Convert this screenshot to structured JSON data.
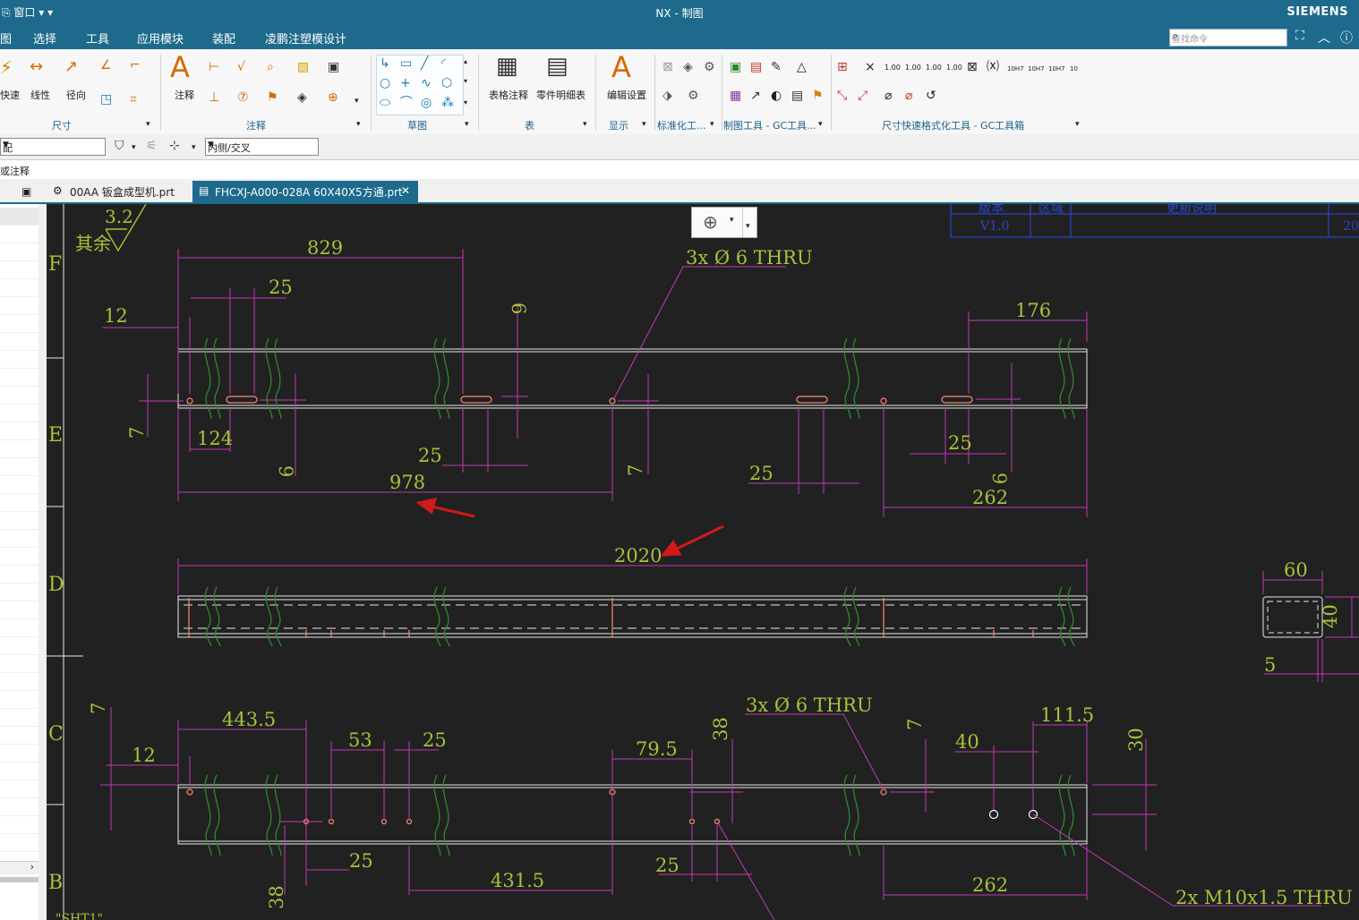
{
  "titlebar": {
    "quick_access": "⎘ 窗口 ▾ ▾",
    "title": "NX - 制图",
    "brand": "SIEMENS"
  },
  "menu": {
    "items": [
      "图",
      "选择",
      "工具",
      "应用模块",
      "装配",
      "凌鹏注塑模设计"
    ],
    "search_placeholder": "查找命令"
  },
  "ribbon": {
    "group_dim": "尺寸",
    "btn_quick": "快速",
    "btn_linear": "线性",
    "btn_radial": "径向",
    "group_annot": "注释",
    "btn_note": "注释",
    "group_sketch": "草图",
    "btn_table_note": "表格注释",
    "btn_parts_list": "零件明细表",
    "group_table": "表",
    "btn_edit_settings": "编辑设置",
    "group_display": "显示",
    "group_std": "标准化工...",
    "group_gc": "制图工具 - GC工具...",
    "group_dimfmt": "尺寸快速格式化工具 - GC工具箱"
  },
  "toolbar2": {
    "combo1": "配",
    "combo2": "内侧/交叉"
  },
  "navigator_header": "或注释",
  "tabs": [
    {
      "label": "00AA 钣盒成型机.prt",
      "active": false
    },
    {
      "label": "FHCXJ-A000-028A 60X40X5方通.prt",
      "active": true
    }
  ],
  "drawing": {
    "zones": [
      "F",
      "E",
      "D",
      "C",
      "B"
    ],
    "roughness_value": "3.2",
    "roughness_note": "其余",
    "revision_headers": [
      "版本",
      "区域",
      "更新说明"
    ],
    "revision_row": [
      "V1.0",
      "",
      "",
      "20"
    ],
    "dims_view1": [
      "829",
      "25",
      "12",
      "6",
      "176",
      "7",
      "124",
      "9",
      "25",
      "978",
      "7",
      "25",
      "25",
      "9",
      "262"
    ],
    "dims_view2": [
      "2020"
    ],
    "dims_section": [
      "60",
      "40",
      "5"
    ],
    "dims_view3": [
      "7",
      "443.5",
      "12",
      "53",
      "25",
      "79.5",
      "38",
      "7",
      "40",
      "111.5",
      "30",
      "25",
      "38",
      "431.5",
      "25",
      "262"
    ],
    "callouts": [
      "3x Ø 6 THRU",
      "3x Ø 6 THRU",
      "2x M10x1.5 THRU"
    ],
    "sheet_label": "\"SHT1\""
  },
  "colors": {
    "titlebar": "#1d6a8c",
    "canvas": "#212121",
    "dimension": "#c03cb4",
    "dim_text": "#a8c23a",
    "callout_prefix": "#d2691e",
    "geometry": "#e6e6e6",
    "break_lines": "#2f8a2f",
    "holes": "#ff8a6e",
    "zone_text": "#a8c23a",
    "arrow_red": "#d21a1a",
    "revision_table": "#2b45c9"
  }
}
